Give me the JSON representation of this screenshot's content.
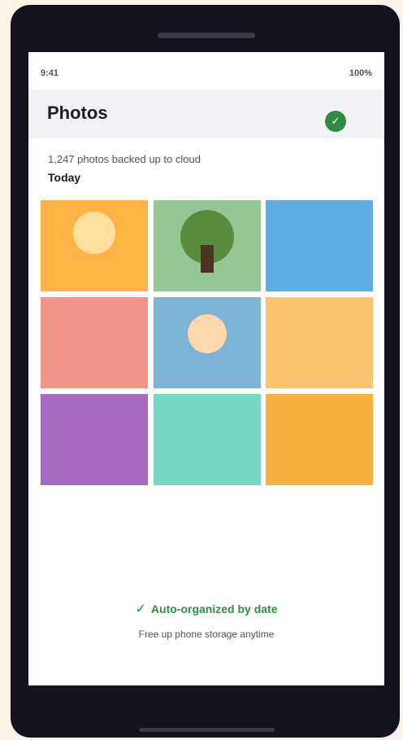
{
  "status_bar": {
    "time": "9:41",
    "battery": "100%"
  },
  "header": {
    "title": "Photos",
    "status_icon": "checkmark-icon",
    "status_glyph": "✓"
  },
  "backup": {
    "summary": "1,247 photos backed up to cloud"
  },
  "section": {
    "date_label": "Today"
  },
  "photos": [
    {
      "color": "#ffb347",
      "subject": "sun",
      "accent": "#ffdf9e"
    },
    {
      "color": "#95c695",
      "subject": "tree",
      "accent": "#5a8a3c"
    },
    {
      "color": "#5dade2",
      "subject": "none"
    },
    {
      "color": "#f1948a",
      "subject": "none"
    },
    {
      "color": "#7fb3d5",
      "subject": "sun",
      "accent": "#fcd9ac"
    },
    {
      "color": "#f8c471",
      "subject": "none"
    },
    {
      "color": "#a569bd",
      "subject": "none"
    },
    {
      "color": "#76d7c4",
      "subject": "none"
    },
    {
      "color": "#f5b041",
      "subject": "none"
    }
  ],
  "footer": {
    "feature_glyph": "✓",
    "feature_text": "Auto-organized by date",
    "sub_text": "Free up phone storage anytime"
  },
  "colors": {
    "accent": "#2f8c46",
    "frame": "#13131e",
    "background": "#fbf3e7"
  }
}
